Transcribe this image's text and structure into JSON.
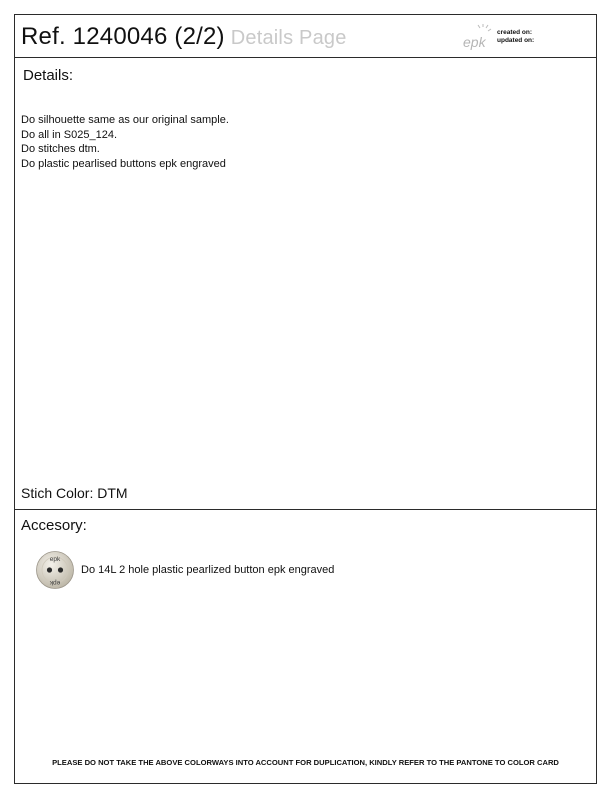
{
  "header": {
    "reference": "Ref.  1240046 (2/2)",
    "page_title": "Details Page",
    "logo_text": "epk",
    "created_label": "created on:",
    "updated_label": "updated on:"
  },
  "details": {
    "title": "Details:",
    "lines": [
      "Do silhouette same as our original sample.",
      "Do all in S025_124.",
      "Do stitches dtm.",
      "Do plastic pearlised buttons epk engraved"
    ],
    "stitch_color": "Stich Color: DTM"
  },
  "accessory": {
    "title": "Accesory:",
    "items": [
      {
        "icon": "pearl-button-icon",
        "engraving": "epk",
        "description": "Do 14L 2 hole plastic pearlized button epk engraved"
      }
    ]
  },
  "footer": {
    "notice": "PLEASE DO NOT TAKE THE ABOVE COLORWAYS INTO ACCOUNT FOR DUPLICATION, KINDLY REFER TO THE PANTONE TO COLOR CARD"
  },
  "colors": {
    "border": "#2b2b2b",
    "muted_title": "#c9c9c9",
    "button_pearl": "#d8d3c6"
  }
}
